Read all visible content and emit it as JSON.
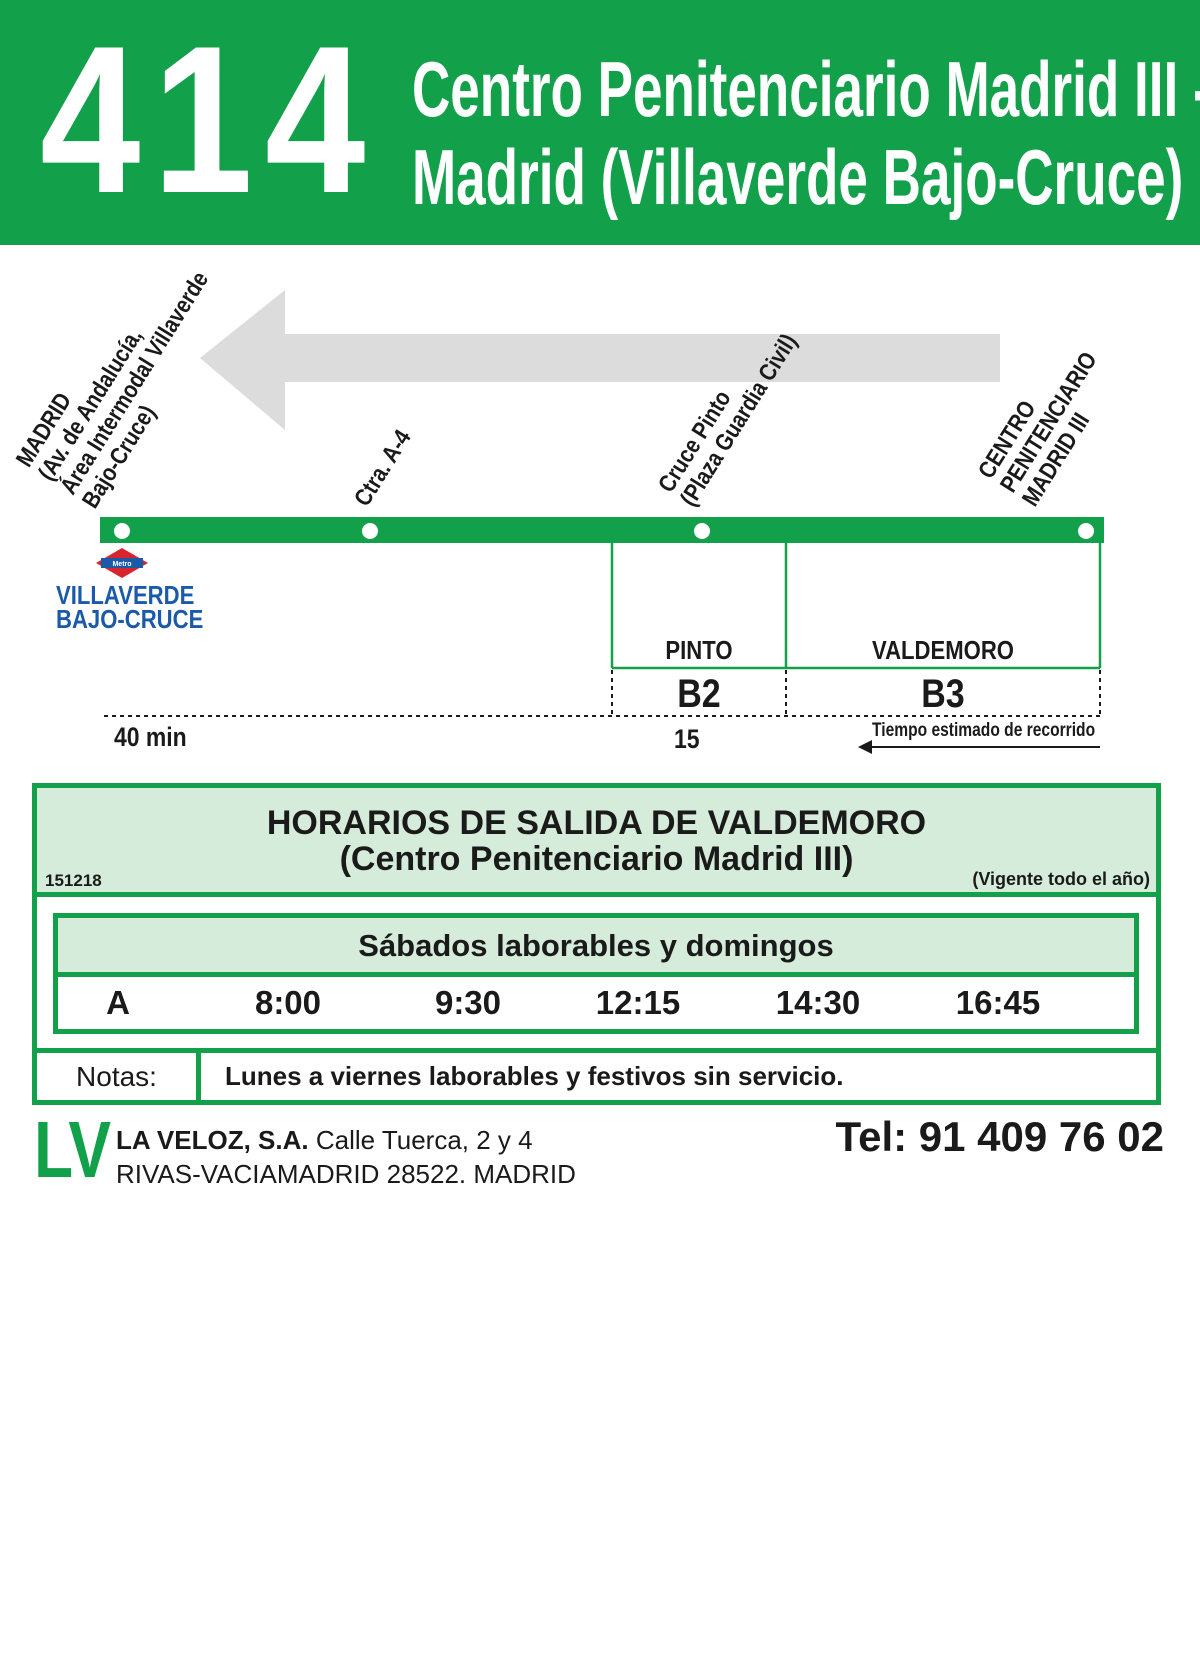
{
  "header": {
    "route_number": "414",
    "title_line1": "Centro Penitenciario Madrid III -",
    "title_line2": "Madrid (Villaverde Bajo-Cruce)"
  },
  "diagram": {
    "stops": [
      {
        "lines": [
          "MADRID",
          "(Av. de Andalucía,",
          "Área Intermodal Villaverde",
          "Bajo-Cruce)"
        ]
      },
      {
        "lines": [
          "Ctra. A-4"
        ]
      },
      {
        "lines": [
          "Cruce Pinto",
          "(Plaza Guardia Civil)"
        ]
      },
      {
        "lines": [
          "CENTRO",
          "PENITENCIARIO",
          "MADRID III"
        ]
      }
    ],
    "metro": {
      "logo_text": "Metro",
      "station_line1": "VILLAVERDE",
      "station_line2": "BAJO-CRUCE"
    },
    "zones": [
      {
        "name": "PINTO",
        "code": "B2"
      },
      {
        "name": "VALDEMORO",
        "code": "B3"
      }
    ],
    "travel_times": [
      "40 min",
      "15"
    ],
    "legend": "Tiempo estimado de recorrido",
    "colors": {
      "route": "#13a04b",
      "direction_arrow": "#dcdcdc",
      "metro_red": "#d8242c",
      "metro_blue": "#1a5aa8"
    }
  },
  "schedule": {
    "title_line1": "HORARIOS DE SALIDA DE VALDEMORO",
    "title_line2": "(Centro Penitenciario Madrid III)",
    "code": "151218",
    "validity": "(Vigente todo el año)",
    "day_type": "Sábados laborables y domingos",
    "row_label": "A",
    "times": [
      "8:00",
      "9:30",
      "12:15",
      "14:30",
      "16:45"
    ],
    "notes_label": "Notas:",
    "notes_text": "Lunes a viernes laborables y festivos sin servicio."
  },
  "footer": {
    "logo": "LV",
    "company_name": "LA VELOZ, S.A.",
    "address_line1": "Calle Tuerca, 2 y 4",
    "address_line2": "RIVAS-VACIAMADRID 28522. MADRID",
    "phone": "Tel: 91 409 76 02"
  }
}
